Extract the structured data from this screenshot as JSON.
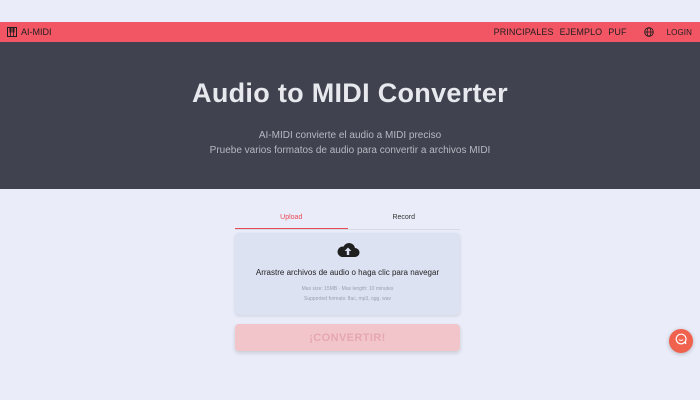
{
  "nav": {
    "brand": "AI-MIDI",
    "links": [
      "PRINCIPALES",
      "EJEMPLO",
      "PUF"
    ],
    "login": "LOGIN"
  },
  "hero": {
    "title": "Audio to MIDI Converter",
    "subtitle_line1": "AI-MIDI convierte el audio a MIDI preciso",
    "subtitle_line2": "Pruebe varios formatos de audio para convertir a archivos MIDI"
  },
  "tabs": [
    {
      "label": "Upload",
      "active": true
    },
    {
      "label": "Record",
      "active": false
    }
  ],
  "dropzone": {
    "text": "Arrastre archivos de audio o haga clic para navegar",
    "limits": "Max size: 15MB · Max length: 10 minutes",
    "formats": "Supported formats: flac, mp3, ogg, wav"
  },
  "convert_label": "¡CONVERTIR!",
  "colors": {
    "accent": "#f25563",
    "hero_bg": "#40434f",
    "page_bg": "#eaedf9",
    "chat_button": "#f0614e"
  },
  "icons": {
    "brand": "piano-icon",
    "language": "globe-icon",
    "upload": "cloud-upload-icon",
    "chat": "chat-icon"
  }
}
